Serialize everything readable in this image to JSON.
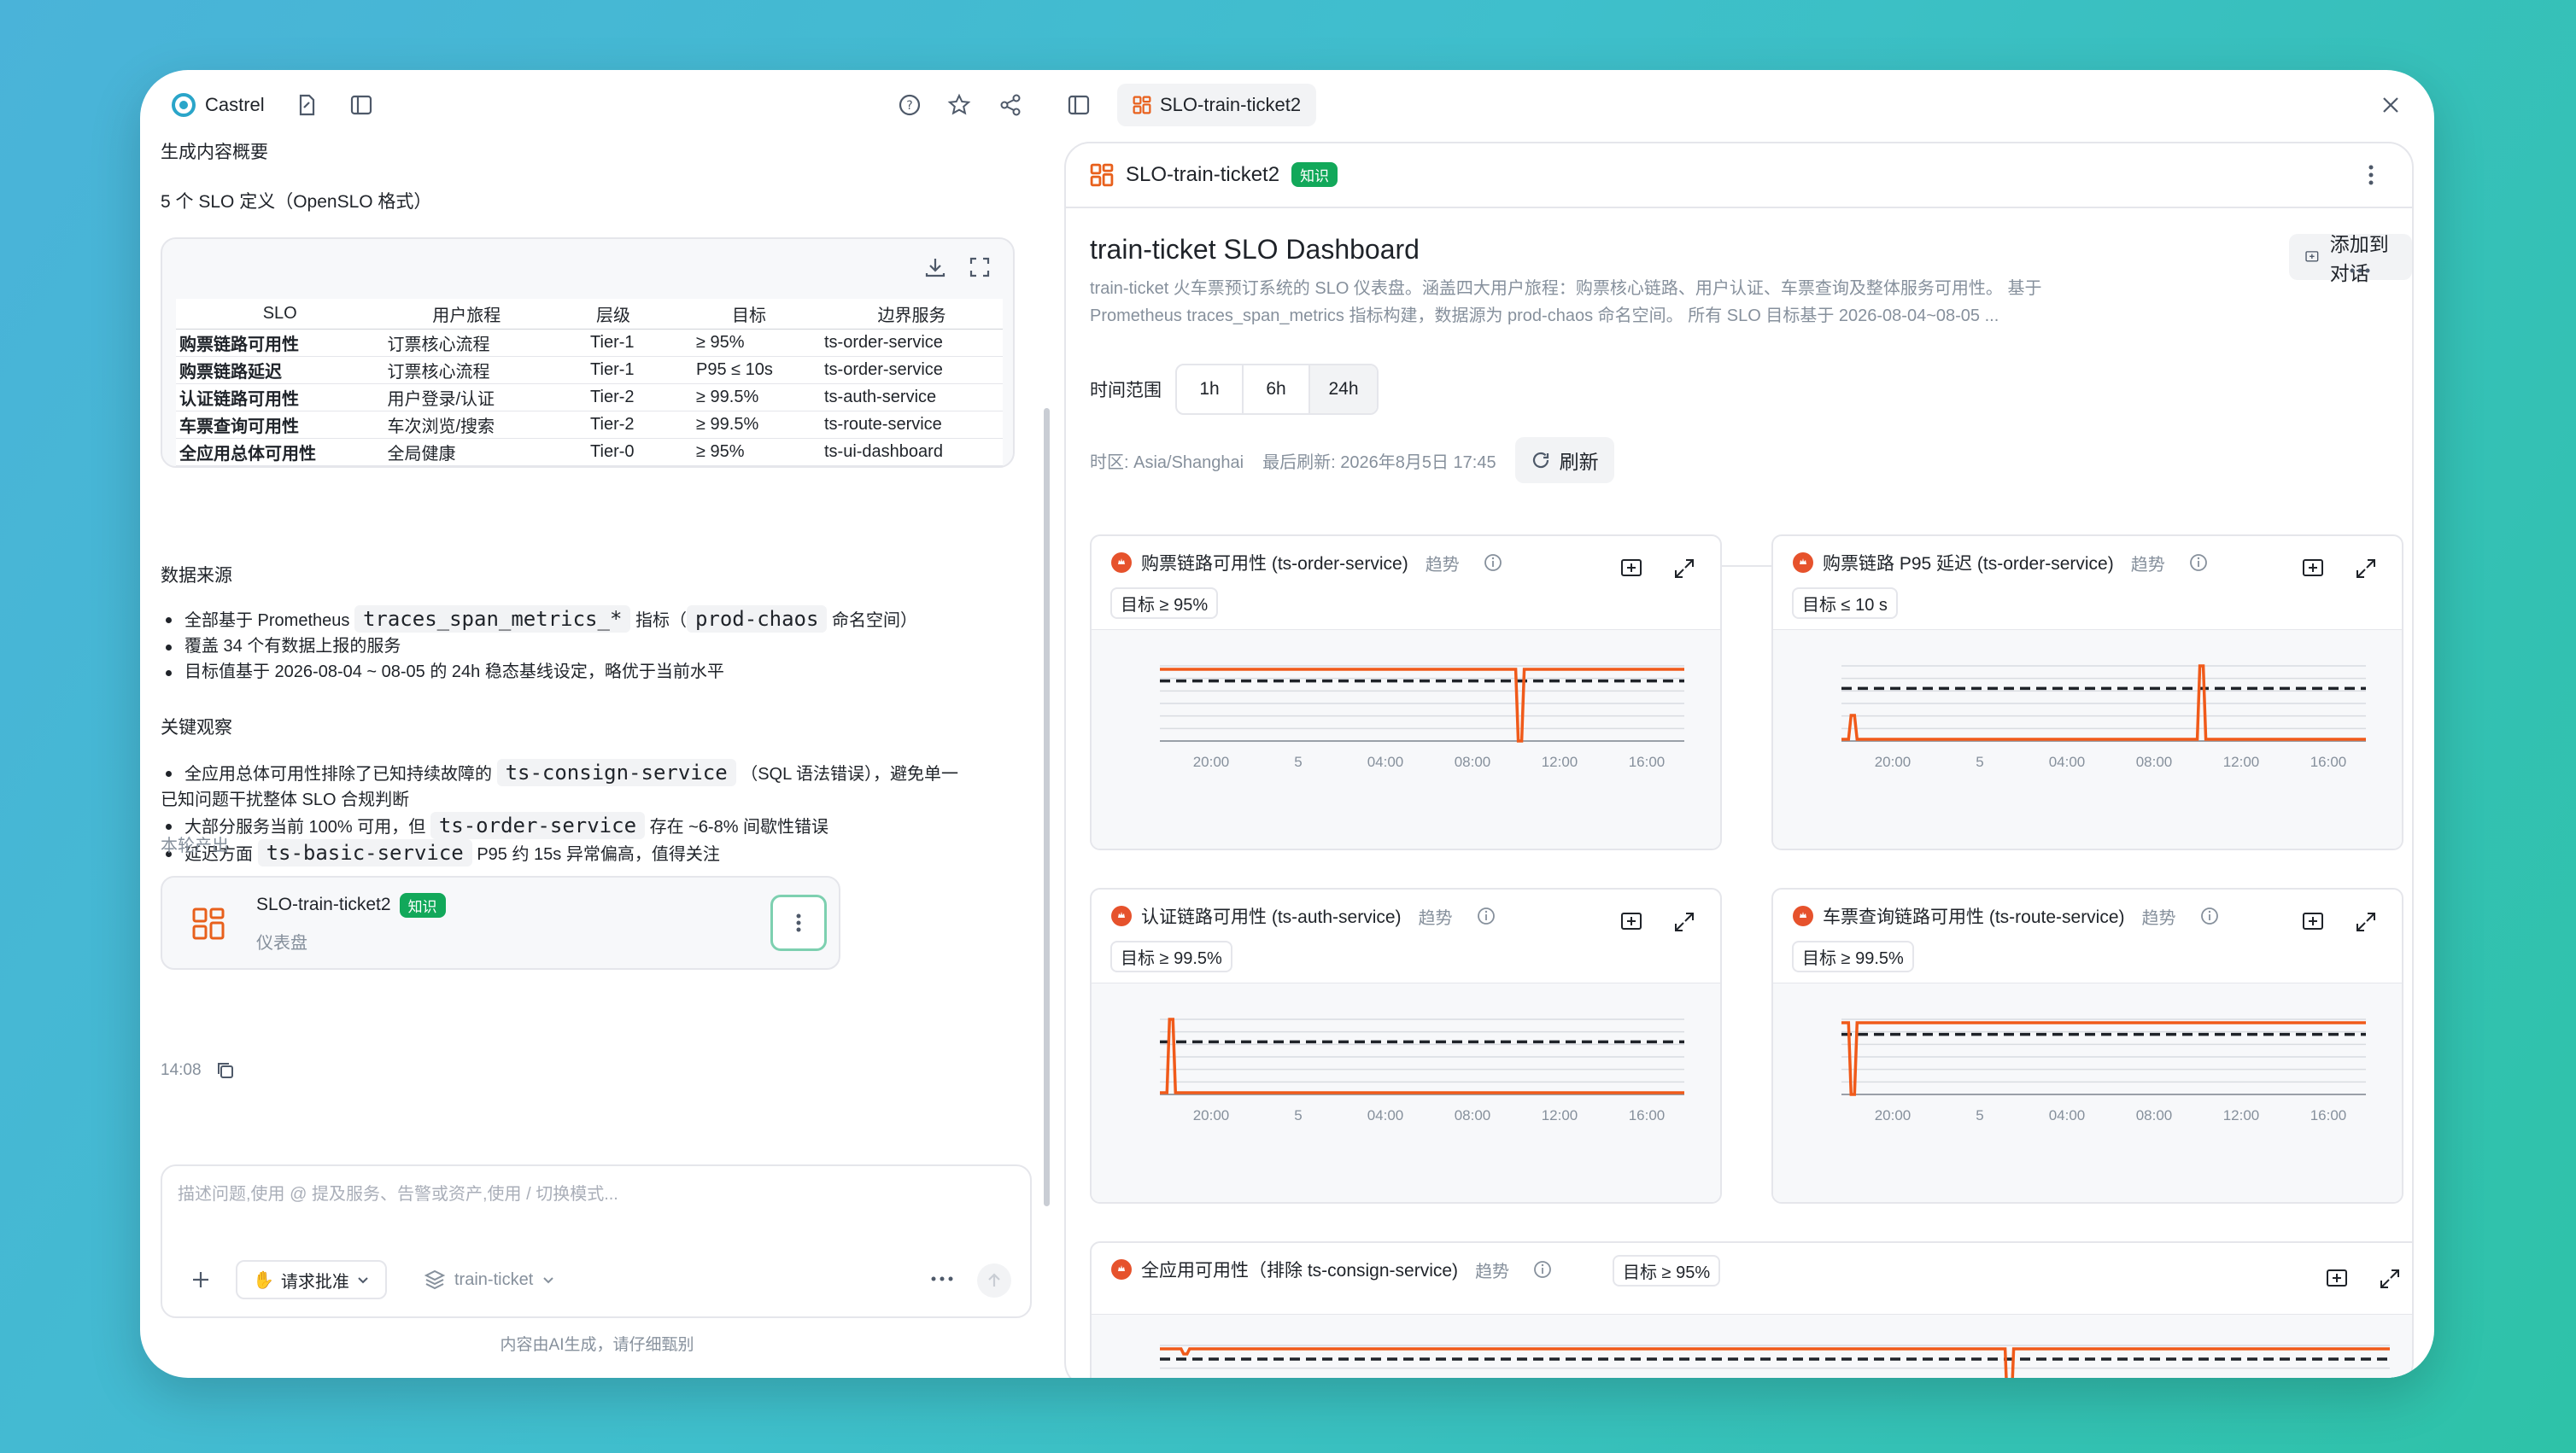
{
  "app": {
    "name": "Castrel"
  },
  "chat": {
    "summary_title": "生成内容概要",
    "slo_count": "5 个 SLO 定义（OpenSLO 格式）",
    "table": {
      "headers": [
        "SLO",
        "用户旅程",
        "层级",
        "目标",
        "边界服务"
      ],
      "rows": [
        [
          "购票链路可用性",
          "订票核心流程",
          "Tier-1",
          "≥ 95%",
          "ts-order-service"
        ],
        [
          "购票链路延迟",
          "订票核心流程",
          "Tier-1",
          "P95 ≤ 10s",
          "ts-order-service"
        ],
        [
          "认证链路可用性",
          "用户登录/认证",
          "Tier-2",
          "≥ 99.5%",
          "ts-auth-service"
        ],
        [
          "车票查询可用性",
          "车次浏览/搜索",
          "Tier-2",
          "≥ 99.5%",
          "ts-route-service"
        ],
        [
          "全应用总体可用性",
          "全局健康",
          "Tier-0",
          "≥ 95%",
          "ts-ui-dashboard"
        ]
      ]
    },
    "data_source_title": "数据来源",
    "ds1_a": "全部基于 Prometheus",
    "ds1_code1": "traces_span_metrics_*",
    "ds1_b": "指标（",
    "ds1_code2": "prod-chaos",
    "ds1_c": "命名空间）",
    "ds2": "覆盖 34 个有数据上报的服务",
    "ds3": "目标值基于 2026-08-04 ~ 08-05 的 24h 稳态基线设定，略优于当前水平",
    "obs_title": "关键观察",
    "obs1_a": "全应用总体可用性排除了已知持续故障的",
    "obs1_code": "ts-consign-service",
    "obs1_b": "（SQL 语法错误），避免单一",
    "obs1_c": "已知问题干扰整体 SLO 合规判断",
    "obs2_a": "大部分服务当前 100% 可用，但",
    "obs2_code": "ts-order-service",
    "obs2_b": "存在 ~6-8% 间歇性错误",
    "obs3_a": "延迟方面",
    "obs3_code": "ts-basic-service",
    "obs3_b": "P95 约 15s 异常偏高，值得关注",
    "output_title": "本轮产出",
    "artifact": {
      "name": "SLO-train-ticket2",
      "badge": "知识",
      "type": "仪表盘"
    },
    "time": "14:08",
    "input": {
      "placeholder": "描述问题,使用 @ 提及服务、告警或资产,使用 / 切换模式...",
      "approval": "请求批准",
      "project": "train-ticket"
    },
    "disclaimer": "内容由AI生成，请仔细甄别"
  },
  "panel": {
    "tab": "SLO-train-ticket2",
    "header_title": "SLO-train-ticket2",
    "header_badge": "知识",
    "dashboard_title": "train-ticket SLO Dashboard",
    "add_to_chat": "添加到对话",
    "desc1": "train-ticket 火车票预订系统的 SLO 仪表盘。涵盖四大用户旅程：购票核心链路、用户认证、车票查询及整体服务可用性。 基于",
    "desc2": "Prometheus traces_span_metrics 指标构建，数据源为 prod-chaos 命名空间。 所有 SLO 目标基于 2026-08-04~08-05 ...",
    "time_range_label": "时间范围",
    "ranges": [
      "1h",
      "6h",
      "24h"
    ],
    "timezone": "时区: Asia/Shanghai",
    "last_refresh": "最后刷新: 2026年8月5日 17:45",
    "refresh": "刷新",
    "trend": "趋势",
    "xticks": [
      "20:00",
      "5",
      "04:00",
      "08:00",
      "12:00",
      "16:00"
    ],
    "cards": [
      {
        "title": "购票链路可用性 (ts-order-service)",
        "target": "目标 ≥ 95%"
      },
      {
        "title": "购票链路 P95 延迟 (ts-order-service)",
        "target": "目标 ≤ 10 s"
      },
      {
        "title": "认证链路可用性 (ts-auth-service)",
        "target": "目标 ≥ 99.5%"
      },
      {
        "title": "车票查询链路可用性 (ts-route-service)",
        "target": "目标 ≥ 99.5%"
      },
      {
        "title": "全应用可用性（排除 ts-consign-service)",
        "target": "目标 ≥ 95%"
      }
    ]
  },
  "colors": {
    "series": "#f05a1a",
    "target_line": "#1f2329",
    "badge": "#12a85a",
    "accent": "#e8601c"
  }
}
